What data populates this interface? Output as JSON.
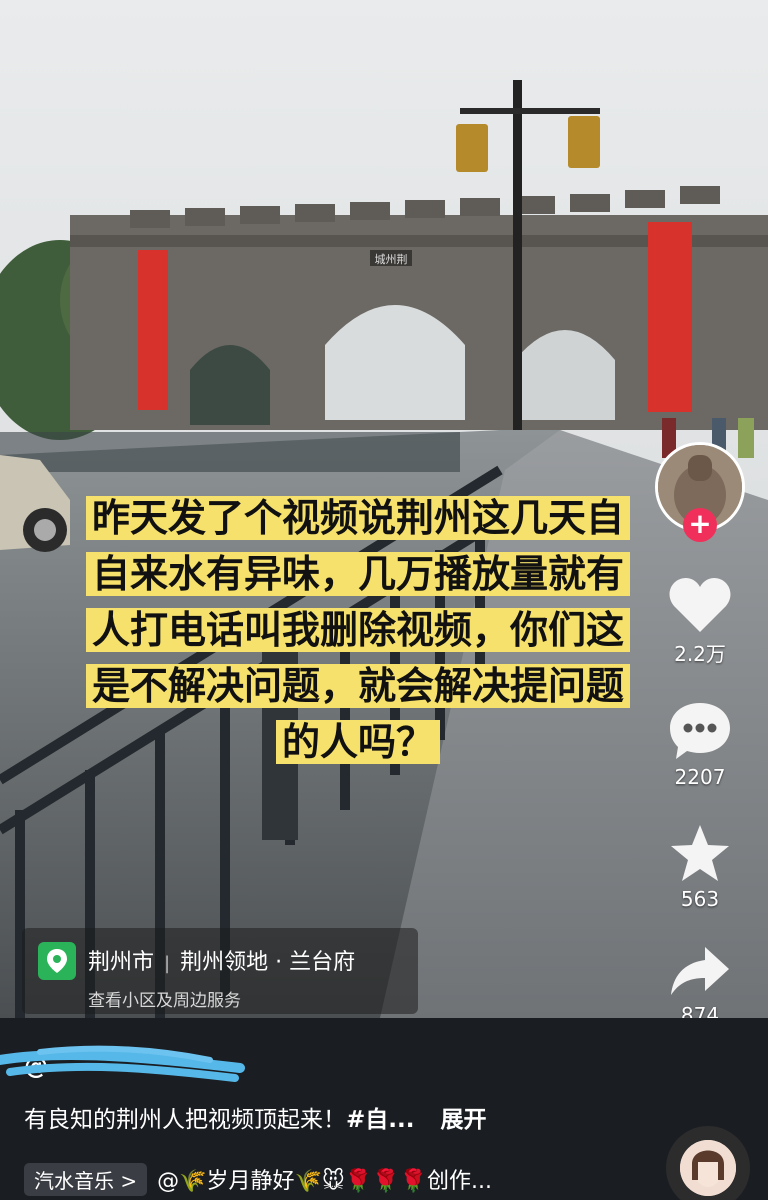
{
  "caption": {
    "lines": [
      "昨天发了个视频说荆州这几天自",
      "自来水有异味，几万播放量就有",
      "人打电话叫我删除视频，你们这",
      "是不解决问题，就会解决提问题",
      "的人吗？"
    ]
  },
  "sign_text": "城州荆",
  "actions": {
    "likes": "2.2万",
    "comments": "2207",
    "favorites": "563",
    "shares": "874"
  },
  "location": {
    "city": "荆州市",
    "place": "荆州领地 · 兰台府",
    "sub": "查看小区及周边服务"
  },
  "post": {
    "author": "@",
    "description": "有良知的荆州人把视频顶起来！",
    "hashtag": "#自...",
    "expand": "展开"
  },
  "music": {
    "chip": "汽水音乐 >",
    "text": "@🌾岁月静好🌾🐭🌹🌹🌹创作..."
  },
  "colors": {
    "caption_bg": "#f5e16b",
    "follow": "#f0305a",
    "location_pin": "#2bb35a",
    "banner_red": "#d8322c"
  },
  "icons": {
    "follow": "plus-icon",
    "like": "heart-icon",
    "comment": "chat-bubble-icon",
    "favorite": "star-icon",
    "share": "share-arrow-icon",
    "location": "location-pin-icon"
  }
}
